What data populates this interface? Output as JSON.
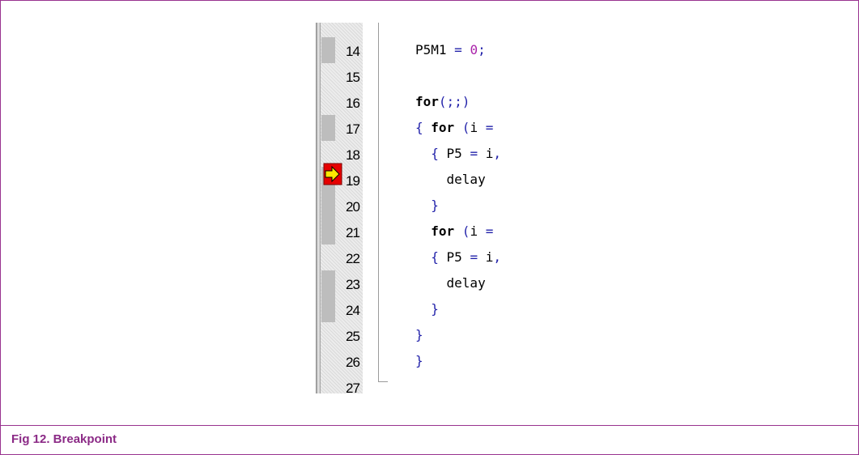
{
  "figure": {
    "caption": "Fig 12.  Breakpoint"
  },
  "editor": {
    "lines": [
      {
        "num": "14",
        "marked": true,
        "tokens": [
          {
            "t": "P5M1 ",
            "c": "id"
          },
          {
            "t": "= ",
            "c": "op"
          },
          {
            "t": "0",
            "c": "num"
          },
          {
            "t": ";",
            "c": "op"
          }
        ]
      },
      {
        "num": "15",
        "marked": false,
        "tokens": []
      },
      {
        "num": "16",
        "marked": false,
        "tokens": [
          {
            "t": "for",
            "c": "kw"
          },
          {
            "t": "(;;)",
            "c": "op"
          }
        ]
      },
      {
        "num": "17",
        "marked": true,
        "tokens": [
          {
            "t": "{ ",
            "c": "op"
          },
          {
            "t": "for ",
            "c": "kw"
          },
          {
            "t": "(",
            "c": "op"
          },
          {
            "t": "i ",
            "c": "id"
          },
          {
            "t": "=",
            "c": "op"
          }
        ]
      },
      {
        "num": "18",
        "marked": false,
        "tokens": [
          {
            "t": "  { ",
            "c": "op"
          },
          {
            "t": "P5 ",
            "c": "id"
          },
          {
            "t": "= ",
            "c": "op"
          },
          {
            "t": "i",
            "c": "id"
          },
          {
            "t": ",",
            "c": "op"
          }
        ]
      },
      {
        "num": "19",
        "marked": true,
        "current": true,
        "tokens": [
          {
            "t": "    delay",
            "c": "id"
          }
        ]
      },
      {
        "num": "20",
        "marked": true,
        "tokens": [
          {
            "t": "  }",
            "c": "op"
          }
        ]
      },
      {
        "num": "21",
        "marked": true,
        "tokens": [
          {
            "t": "  ",
            "c": "id"
          },
          {
            "t": "for ",
            "c": "kw"
          },
          {
            "t": "(",
            "c": "op"
          },
          {
            "t": "i ",
            "c": "id"
          },
          {
            "t": "=",
            "c": "op"
          }
        ]
      },
      {
        "num": "22",
        "marked": false,
        "tokens": [
          {
            "t": "  { ",
            "c": "op"
          },
          {
            "t": "P5 ",
            "c": "id"
          },
          {
            "t": "= ",
            "c": "op"
          },
          {
            "t": "i",
            "c": "id"
          },
          {
            "t": ",",
            "c": "op"
          }
        ]
      },
      {
        "num": "23",
        "marked": true,
        "tokens": [
          {
            "t": "    delay",
            "c": "id"
          }
        ]
      },
      {
        "num": "24",
        "marked": true,
        "tokens": [
          {
            "t": "  }",
            "c": "op"
          }
        ]
      },
      {
        "num": "25",
        "marked": false,
        "tokens": [
          {
            "t": "}",
            "c": "op"
          }
        ]
      },
      {
        "num": "26",
        "marked": false,
        "tokens": [
          {
            "t": "}",
            "c": "op"
          }
        ]
      },
      {
        "num": "27",
        "marked": false,
        "tokens": []
      }
    ]
  },
  "colors": {
    "frame": "#99338f",
    "caption": "#8b2a86",
    "operator": "#2222aa",
    "number": "#aa22aa",
    "breakpoint_bg": "#bdbdbd"
  },
  "icons": {
    "current_line": "execution-arrow-icon"
  }
}
